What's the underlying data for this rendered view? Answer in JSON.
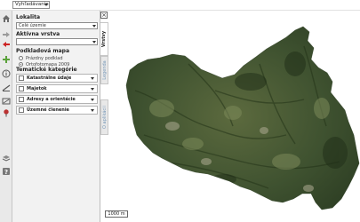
{
  "topbar": {
    "search_select": "Vyhľadávanie"
  },
  "toolbar": {
    "tools": [
      {
        "name": "home-icon",
        "color": "#6b6b6b"
      },
      {
        "name": "arrow-right-icon",
        "color": "#9a9a9a"
      },
      {
        "name": "arrow-left-icon",
        "color": "#cc2222"
      },
      {
        "name": "plus-icon",
        "color": "#5aa23a"
      },
      {
        "name": "info-icon",
        "color": "#555555"
      },
      {
        "name": "measure-line-icon",
        "color": "#555555"
      },
      {
        "name": "measure-area-icon",
        "color": "#555555"
      },
      {
        "name": "pin-icon",
        "color": "#b33"
      },
      {
        "name": "layers-icon",
        "color": "#666666"
      },
      {
        "name": "help-icon",
        "color": "#666666"
      }
    ]
  },
  "panel": {
    "lokalita_label": "Lokalita",
    "lokalita_value": "Celé územie",
    "aktivna_vrstva_label": "Aktívna vrstva",
    "aktivna_vrstva_value": "",
    "podkladova_mapa_label": "Podkladová mapa",
    "basemap_options": [
      {
        "label": "Prázdny podklad",
        "checked": false
      },
      {
        "label": "Ortofotomapa 2009",
        "checked": true
      }
    ],
    "tematicke_label": "Tematické kategórie",
    "categories": [
      "Katastrálne údaje",
      "Majetok",
      "Adresy a orientácie",
      "Územné členenie"
    ]
  },
  "tabs": {
    "close_label": "×",
    "items": [
      "Vrstvy",
      "Legenda",
      "O aplikácii"
    ]
  },
  "map": {
    "scale_label": "1000 m"
  }
}
